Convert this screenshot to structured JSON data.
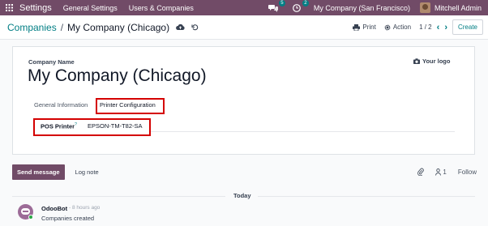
{
  "navbar": {
    "brand": "Settings",
    "menu": [
      "General Settings",
      "Users & Companies"
    ],
    "chat_badge": "5",
    "activity_badge": "2",
    "company": "My Company (San Francisco)",
    "user": "Mitchell Admin",
    "colors": {
      "bg": "#714b67",
      "badge": "#017e84"
    }
  },
  "control": {
    "breadcrumb_parent": "Companies",
    "breadcrumb_separator": "/",
    "breadcrumb_current": "My Company (Chicago)",
    "print_label": "Print",
    "action_label": "Action",
    "pager": "1 / 2",
    "create_label": "Create"
  },
  "form": {
    "company_name_label": "Company Name",
    "company_name": "My Company (Chicago)",
    "logo_label": "Your logo",
    "tabs": [
      "General Information",
      "Printer Configuration"
    ],
    "pos_printer_label": "POS Printer",
    "pos_printer_help": "?",
    "pos_printer_value": "EPSON-TM-T82-SA"
  },
  "chatter": {
    "send_message": "Send message",
    "log_note": "Log note",
    "followers_count": "1",
    "follow_label": "Follow",
    "today_label": "Today",
    "message": {
      "author": "OdooBot",
      "time": "- 8 hours ago",
      "body": "Companies created"
    }
  },
  "icons": {
    "apps": "apps-grid-icon",
    "chat": "chat-bubbles-icon",
    "activity": "clock-icon",
    "cloud": "cloud-upload-icon",
    "discard": "undo-icon",
    "print": "printer-icon",
    "action": "gear-icon",
    "logo": "camera-icon",
    "attachment": "paperclip-icon",
    "followers": "user-icon"
  },
  "highlight_color": "#d40000"
}
